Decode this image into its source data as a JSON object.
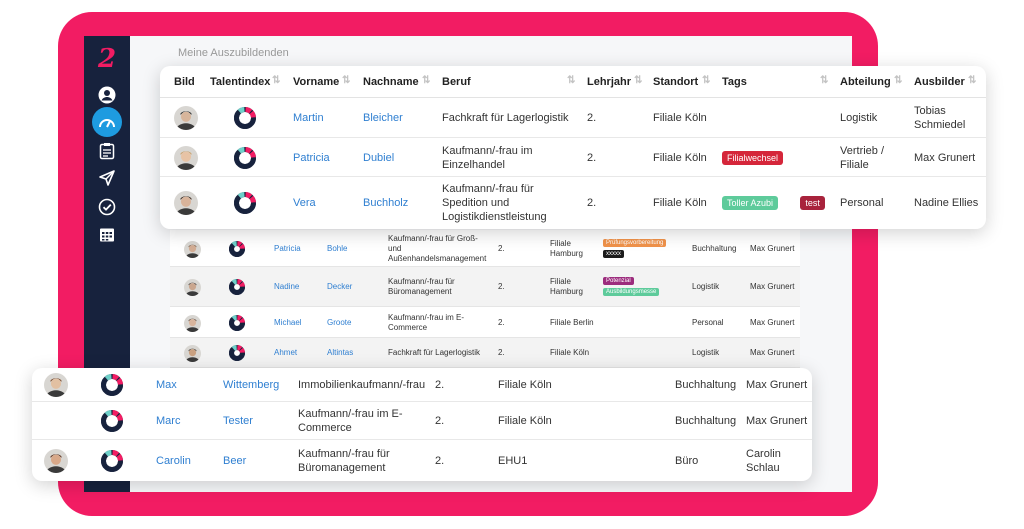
{
  "app": {
    "title": "Meine Auszubildenden",
    "logo": "2"
  },
  "sidebar": {
    "items": [
      {
        "icon": "user-icon",
        "label": "Profil"
      },
      {
        "icon": "dashboard-icon",
        "label": "Dashboard",
        "active": true
      },
      {
        "icon": "clipboard-icon",
        "label": "Aufgaben"
      },
      {
        "icon": "send-icon",
        "label": "Nachrichten"
      },
      {
        "icon": "check-circle-icon",
        "label": "Bewertungen"
      },
      {
        "icon": "calendar-icon",
        "label": "Kalender"
      }
    ]
  },
  "table": {
    "columns": [
      "Bild",
      "Talentindex",
      "Vorname",
      "Nachname",
      "Beruf",
      "Lehrjahr",
      "Standort",
      "Tags",
      "Abteilung",
      "Ausbilder"
    ],
    "top_rows": [
      {
        "vorname": "Martin",
        "nachname": "Bleicher",
        "beruf": "Fachkraft für Lagerlogistik",
        "lehrjahr": "2.",
        "standort": "Filiale Köln",
        "tags": [],
        "abteilung": "Logistik",
        "ausbilder": "Tobias\nSchmiedel",
        "index": "65"
      },
      {
        "vorname": "Patricia",
        "nachname": "Dubiel",
        "beruf": "Kaufmann/-frau im\nEinzelhandel",
        "lehrjahr": "2.",
        "standort": "Filiale Köln",
        "tags": [
          {
            "label": "Filialwechsel",
            "color": "#d5263a"
          }
        ],
        "abteilung": "Vertrieb /\nFiliale",
        "ausbilder": "Max Grunert",
        "index": "28"
      },
      {
        "vorname": "Vera",
        "nachname": "Buchholz",
        "beruf": "Kaufmann/-frau für\nSpedition und\nLogistikdienstleistung",
        "lehrjahr": "2.",
        "standort": "Filiale Köln",
        "tags": [
          {
            "label": "Toller Azubi",
            "color": "#5ecb9b"
          },
          {
            "label": "test",
            "color": "#a8233c"
          }
        ],
        "abteilung": "Personal",
        "ausbilder": "Nadine Ellies",
        "index": "24"
      }
    ],
    "middle_rows": [
      {
        "vorname": "Patricia",
        "nachname": "Bohle",
        "beruf": "Kaufmann/-frau für Groß-\nund\nAußenhandelsmanagement",
        "lehrjahr": "2.",
        "standort": "Filiale\nHamburg",
        "tags": [
          {
            "label": "Prüfungsvorbereitung",
            "color": "#f0924a"
          },
          {
            "label": "xxxxx",
            "color": "#1b1b1b"
          }
        ],
        "abteilung": "Buchhaltung",
        "ausbilder": "Max Grunert"
      },
      {
        "vorname": "Nadine",
        "nachname": "Decker",
        "beruf": "Kaufmann/-frau für\nBüromanagement",
        "lehrjahr": "2.",
        "standort": "Filiale\nHamburg",
        "tags": [
          {
            "label": "Potenzial",
            "color": "#9c2c7d"
          },
          {
            "label": "Ausbildungsmesse",
            "color": "#5ecb9b"
          }
        ],
        "abteilung": "Logistik",
        "ausbilder": "Max Grunert"
      },
      {
        "vorname": "Michael",
        "nachname": "Groote",
        "beruf": "Kaufmann/-frau im E-\nCommerce",
        "lehrjahr": "2.",
        "standort": "Filiale Berlin",
        "tags": [],
        "abteilung": "Personal",
        "ausbilder": "Max Grunert"
      },
      {
        "vorname": "Ahmet",
        "nachname": "Altintas",
        "beruf": "Fachkraft für Lagerlogistik",
        "lehrjahr": "2.",
        "standort": "Filiale Köln",
        "tags": [],
        "abteilung": "Logistik",
        "ausbilder": "Max Grunert"
      }
    ],
    "bottom_rows": [
      {
        "vorname": "Max",
        "nachname": "Wittemberg",
        "beruf": "Immobilienkaufmann/-frau",
        "lehrjahr": "2.",
        "standort": "Filiale Köln",
        "abteilung": "Buchhaltung",
        "ausbilder": "Max Grunert"
      },
      {
        "vorname": "Marc",
        "nachname": "Tester",
        "beruf": "Kaufmann/-frau im E-\nCommerce",
        "lehrjahr": "2.",
        "standort": "Filiale Köln",
        "abteilung": "Buchhaltung",
        "ausbilder": "Max Grunert"
      },
      {
        "vorname": "Carolin",
        "nachname": "Beer",
        "beruf": "Kaufmann/-frau für\nBüromanagement",
        "lehrjahr": "2.",
        "standort": "EHU1",
        "abteilung": "Büro",
        "ausbilder": "Carolin\nSchlau"
      }
    ]
  }
}
